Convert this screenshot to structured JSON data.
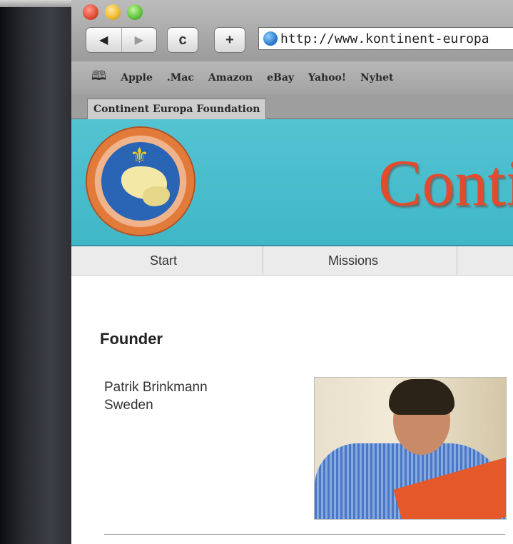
{
  "browser": {
    "nav_back": "◀",
    "nav_forward": "▶",
    "reload_glyph": "c",
    "add_glyph": "+",
    "url": "http://www.kontinent-europa",
    "bookmarks": [
      "Apple",
      ".Mac",
      "Amazon",
      "eBay",
      "Yahoo!",
      "Nyhet"
    ],
    "tab_title": "Continent Europa Foundation"
  },
  "site": {
    "title": "Conti",
    "nav": [
      "Start",
      "Missions"
    ],
    "colors": {
      "banner": "#45bccc",
      "title": "#e44b2c"
    }
  },
  "content": {
    "heading": "Founder",
    "name": "Patrik Brinkmann",
    "country": "Sweden"
  }
}
